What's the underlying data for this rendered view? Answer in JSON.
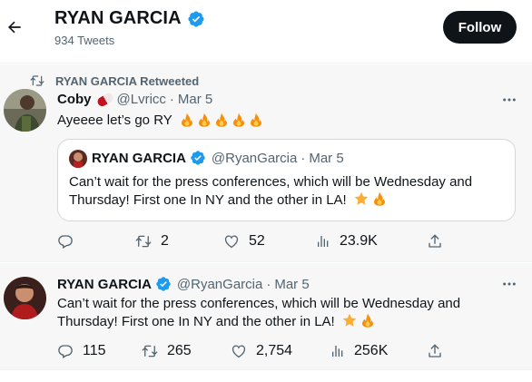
{
  "header": {
    "name": "RYAN GARCIA",
    "tweet_count": "934 Tweets",
    "follow_label": "Follow"
  },
  "tweets": [
    {
      "retweet_label": "RYAN GARCIA Retweeted",
      "author_name": "Coby",
      "handle": "@Lvricc",
      "separator": "·",
      "date": "Mar 5",
      "text": "Ayeeee let’s go RY",
      "emojis": [
        "fire",
        "fire",
        "fire",
        "fire",
        "fire"
      ],
      "quote": {
        "author_name": "RYAN GARCIA",
        "handle": "@RyanGarcia",
        "separator": "·",
        "date": "Mar 5",
        "line1": "Can’t wait for the press conferences, which will be Wednesday and",
        "line2": "Thursday! First one In NY and the other in LA!"
      },
      "stats": {
        "replies": "",
        "retweets": "2",
        "likes": "52",
        "views": "23.9K"
      }
    },
    {
      "author_name": "RYAN GARCIA",
      "handle": "@RyanGarcia",
      "separator": "·",
      "date": "Mar 5",
      "line1": "Can’t wait for the press conferences, which will be Wednesday and",
      "line2": "Thursday! First one In NY and the other in LA!",
      "stats": {
        "replies": "115",
        "retweets": "265",
        "likes": "2,754",
        "views": "256K"
      }
    }
  ],
  "colors": {
    "verified": "#1d9bf0",
    "text_primary": "#0f1419",
    "text_secondary": "#536471",
    "follow_bg": "#0f1419",
    "tweet_bg": "#f7f7f7"
  },
  "icons": {
    "back": "arrow-left-icon",
    "verified": "verified-badge-icon",
    "retweet": "retweet-icon",
    "more": "more-dots-icon",
    "reply": "reply-icon",
    "like": "heart-icon",
    "views": "views-icon",
    "share": "share-icon",
    "star": "star-emoji",
    "fire": "fire-emoji"
  }
}
